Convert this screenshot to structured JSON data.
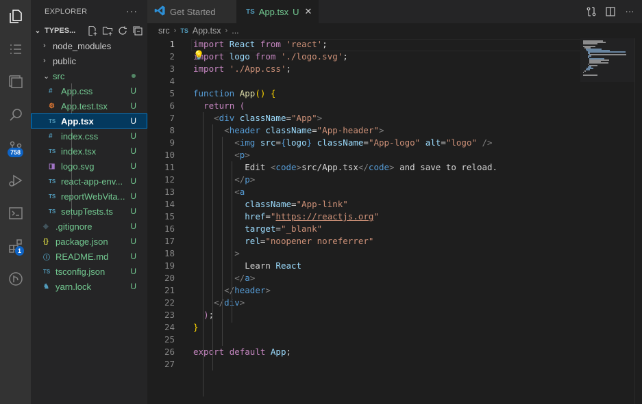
{
  "sidebar": {
    "title": "EXPLORER",
    "more": "···",
    "project": "TYPES...",
    "items": [
      {
        "name": "node_modules",
        "type": "folder",
        "chevron": "›",
        "status": ""
      },
      {
        "name": "public",
        "type": "folder",
        "chevron": "›",
        "status": ""
      },
      {
        "name": "src",
        "type": "folder",
        "chevron": "⌄",
        "status": "dot"
      },
      {
        "name": "App.css",
        "type": "css",
        "icon": "#",
        "status": "U"
      },
      {
        "name": "App.test.tsx",
        "type": "test",
        "icon": "⚙",
        "status": "U"
      },
      {
        "name": "App.tsx",
        "type": "ts",
        "icon": "TS",
        "status": "U",
        "selected": true
      },
      {
        "name": "index.css",
        "type": "css",
        "icon": "#",
        "status": "U"
      },
      {
        "name": "index.tsx",
        "type": "ts",
        "icon": "TS",
        "status": "U"
      },
      {
        "name": "logo.svg",
        "type": "svg",
        "icon": "◨",
        "status": "U"
      },
      {
        "name": "react-app-env...",
        "type": "ts",
        "icon": "TS",
        "status": "U"
      },
      {
        "name": "reportWebVita...",
        "type": "ts",
        "icon": "TS",
        "status": "U"
      },
      {
        "name": "setupTests.ts",
        "type": "ts",
        "icon": "TS",
        "status": "U"
      },
      {
        "name": ".gitignore",
        "type": "git",
        "icon": "◆",
        "status": "U"
      },
      {
        "name": "package.json",
        "type": "json",
        "icon": "{}",
        "status": "U"
      },
      {
        "name": "README.md",
        "type": "info",
        "icon": "ⓘ",
        "status": "U"
      },
      {
        "name": "tsconfig.json",
        "type": "tsconfig",
        "icon": "TS",
        "status": "U"
      },
      {
        "name": "yarn.lock",
        "type": "yarn",
        "icon": "♞",
        "status": "U"
      }
    ]
  },
  "activity": {
    "badges": {
      "scm": "758",
      "extensions": "1"
    }
  },
  "tabs": [
    {
      "label": "Get Started",
      "active": false
    },
    {
      "label": "App.tsx",
      "icon": "TS",
      "modified": "U",
      "close": "✕",
      "active": true
    }
  ],
  "breadcrumb": {
    "folder": "src",
    "file_icon": "TS",
    "file": "App.tsx",
    "more": "..."
  },
  "editor": {
    "line_numbers": [
      "1",
      "2",
      "3",
      "4",
      "5",
      "6",
      "7",
      "8",
      "9",
      "10",
      "11",
      "12",
      "13",
      "14",
      "15",
      "16",
      "17",
      "18",
      "19",
      "20",
      "21",
      "22",
      "23",
      "24",
      "25",
      "26",
      "27"
    ],
    "lines": [
      "import React from 'react';",
      "import logo from './logo.svg';",
      "import './App.css';",
      "",
      "function App() {",
      "  return (",
      "    <div className=\"App\">",
      "      <header className=\"App-header\">",
      "        <img src={logo} className=\"App-logo\" alt=\"logo\" />",
      "        <p>",
      "          Edit <code>src/App.tsx</code> and save to reload.",
      "        </p>",
      "        <a",
      "          className=\"App-link\"",
      "          href=\"https://reactjs.org\"",
      "          target=\"_blank\"",
      "          rel=\"noopener noreferrer\"",
      "        >",
      "          Learn React",
      "        </a>",
      "      </header>",
      "    </div>",
      "  );",
      "}",
      "",
      "export default App;",
      ""
    ]
  }
}
